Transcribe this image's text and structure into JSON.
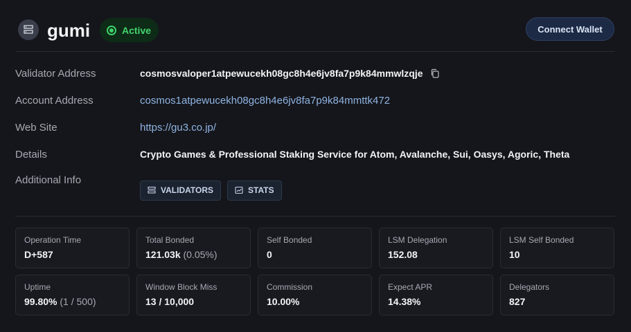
{
  "header": {
    "name": "gumi",
    "status": "Active",
    "connect_label": "Connect Wallet",
    "status_color": "#3ed26b"
  },
  "details": [
    {
      "label": "Validator Address",
      "value": "cosmosvaloper1atpewucekh08gc8h4e6jv8fa7p9k84mmwlzqje",
      "type": "text"
    },
    {
      "label": "Account Address",
      "value": "cosmos1atpewucekh08gc8h4e6jv8fa7p9k84mmttk472",
      "type": "link"
    },
    {
      "label": "Web Site",
      "value": "https://gu3.co.jp/",
      "type": "link"
    },
    {
      "label": "Details",
      "value": "Crypto Games & Professional Staking Service for Atom, Avalanche, Sui, Oasys, Agoric, Theta",
      "type": "text"
    },
    {
      "label": "Additional Info",
      "type": "tags"
    }
  ],
  "tags": [
    {
      "label": "VALIDATORS",
      "icon": "server-icon"
    },
    {
      "label": "STATS",
      "icon": "chart-icon"
    }
  ],
  "stats": [
    {
      "label": "Operation Time",
      "value": "D+587",
      "sub": ""
    },
    {
      "label": "Total Bonded",
      "value": "121.03k",
      "sub": " (0.05%)"
    },
    {
      "label": "Self Bonded",
      "value": "0",
      "sub": ""
    },
    {
      "label": "LSM Delegation",
      "value": "152.08",
      "sub": ""
    },
    {
      "label": "LSM Self Bonded",
      "value": "10",
      "sub": ""
    },
    {
      "label": "Uptime",
      "value": "99.80%",
      "sub": " (1 / 500)"
    },
    {
      "label": "Window Block Miss",
      "value": "13 / 10,000",
      "sub": ""
    },
    {
      "label": "Commission",
      "value": "10.00%",
      "sub": ""
    },
    {
      "label": "Expect APR",
      "value": "14.38%",
      "sub": ""
    },
    {
      "label": "Delegators",
      "value": "827",
      "sub": ""
    }
  ]
}
